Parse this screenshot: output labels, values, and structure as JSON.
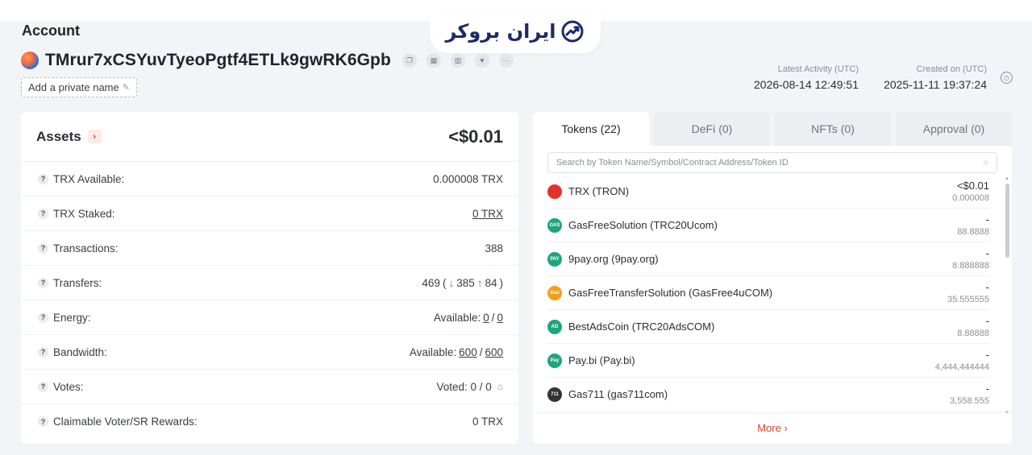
{
  "watermark": {
    "text": "ایران بروکر",
    "color": "#1b2a6b"
  },
  "account": {
    "title": "Account",
    "address": "TMrur7xCSYuvTyeoPgtf4ETLk9gwRK6Gpb",
    "private_name_label": "Add a private name",
    "icons": [
      "copy-icon",
      "qr-code-icon",
      "chart-icon",
      "heart-icon",
      "more-icon"
    ]
  },
  "meta": {
    "latest_activity_label": "Latest Activity (UTC)",
    "latest_activity_value": "2026-08-14 12:49:51",
    "created_label": "Created on (UTC)",
    "created_value": "2025-11-11 19:37:24"
  },
  "assets": {
    "title": "Assets",
    "total": "<$0.01",
    "rows": {
      "trx_available": {
        "label": "TRX Available:",
        "value": "0.000008 TRX"
      },
      "trx_staked": {
        "label": "TRX Staked:",
        "value": "0 TRX"
      },
      "transactions": {
        "label": "Transactions:",
        "value": "388"
      },
      "transfers": {
        "label": "Transfers:",
        "total": "469",
        "open": "(",
        "in_arrow": "↓",
        "in": "385",
        "out_arrow": "↑",
        "out": "84",
        "close": ")"
      },
      "energy": {
        "label": "Energy:",
        "prefix": "Available:",
        "used": "0",
        "sep": "/",
        "max": "0"
      },
      "bandwidth": {
        "label": "Bandwidth:",
        "prefix": "Available:",
        "used": "600",
        "sep": "/",
        "max": "600"
      },
      "votes": {
        "label": "Votes:",
        "value": "Voted: 0 / 0"
      },
      "rewards": {
        "label": "Claimable Voter/SR Rewards:",
        "value": "0 TRX"
      }
    }
  },
  "tabs": [
    {
      "label": "Tokens",
      "count": "(22)"
    },
    {
      "label": "DeFi",
      "count": "(0)"
    },
    {
      "label": "NFTs",
      "count": "(0)"
    },
    {
      "label": "Approval",
      "count": "(0)"
    }
  ],
  "search": {
    "placeholder": "Search by Token Name/Symbol/Contract Address/Token ID"
  },
  "tokens": [
    {
      "name": "TRX (TRON)",
      "usd": "<$0.01",
      "amount": "0.000008",
      "icon_text": "",
      "color": "#e4322b"
    },
    {
      "name": "GasFreeSolution (TRC20Ucom)",
      "usd": "-",
      "amount": "88.8888",
      "icon_text": "GAS",
      "color": "#1fa57a"
    },
    {
      "name": "9pay.org (9pay.org)",
      "usd": "-",
      "amount": "8.888888",
      "icon_text": "PAY",
      "color": "#1fa57a"
    },
    {
      "name": "GasFreeTransferSolution (GasFree4uCOM)",
      "usd": "-",
      "amount": "35.555555",
      "icon_text": "Gas",
      "color": "#f0a020"
    },
    {
      "name": "BestAdsCoin (TRC20AdsCOM)",
      "usd": "-",
      "amount": "8.88888",
      "icon_text": "AD",
      "color": "#1fa57a"
    },
    {
      "name": "Pay.bi (Pay.bi)",
      "usd": "-",
      "amount": "4,444,444444",
      "icon_text": "Pay",
      "color": "#1fa57a"
    },
    {
      "name": "Gas711 (gas711com)",
      "usd": "-",
      "amount": "3,558.555",
      "icon_text": "711",
      "color": "#333333"
    }
  ],
  "more_label": "More",
  "colors": {
    "accent": "#d8432d",
    "inbound": "#19a35a",
    "outbound": "#e2412d"
  }
}
